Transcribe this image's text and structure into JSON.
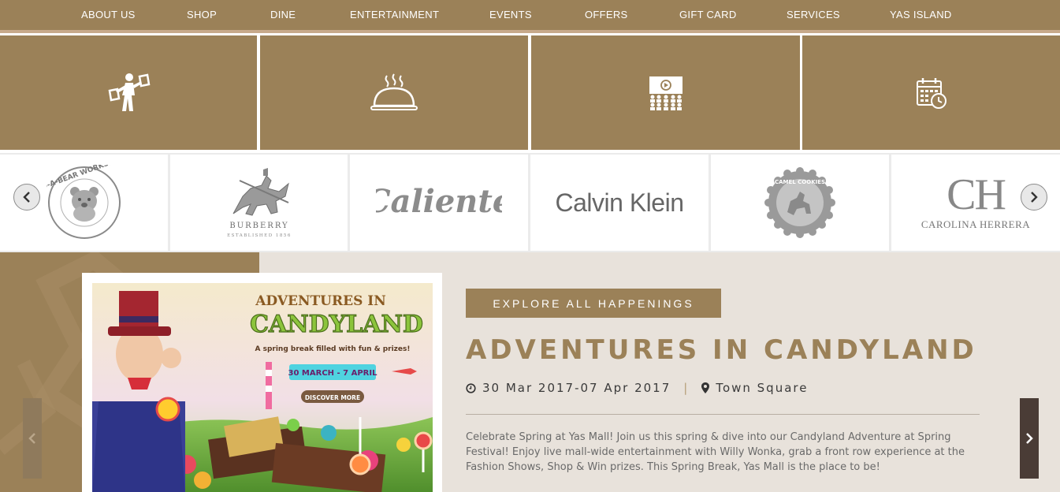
{
  "nav": {
    "items": [
      "ABOUT US",
      "SHOP",
      "DINE",
      "ENTERTAINMENT",
      "EVENTS",
      "OFFERS",
      "GIFT CARD",
      "SERVICES",
      "YAS ISLAND"
    ]
  },
  "category_tiles": [
    {
      "icon": "shopping-person-icon"
    },
    {
      "icon": "dining-cloche-icon"
    },
    {
      "icon": "cinema-audience-icon"
    },
    {
      "icon": "calendar-clock-icon"
    }
  ],
  "brands": {
    "items": [
      {
        "name": "BUILD-A-BEAR WORKSHOP"
      },
      {
        "name": "BURBERRY",
        "sub": "ESTABLISHED 1856"
      },
      {
        "name": "Caliente"
      },
      {
        "name": "Calvin Klein"
      },
      {
        "name": "CAMEL COOKIES"
      },
      {
        "name": "CH",
        "sub": "CAROLINA HERRERA"
      }
    ],
    "prev_icon": "chevron-left-icon",
    "next_icon": "chevron-right-icon"
  },
  "hero": {
    "explore_label": "EXPLORE ALL HAPPENINGS",
    "title": "ADVENTURES IN CANDYLAND",
    "date": "30 Mar 2017-07 Apr 2017",
    "separator": "|",
    "location": "Town Square",
    "description": "Celebrate Spring at Yas Mall! Join us this spring & dive into our Candyland Adventure at Spring Festival! Enjoy live mall-wide entertainment with Willy Wonka, grab a front row experience at the Fashion Shows, Shop & Win prizes. This Spring Break, Yas Mall is the place to be!",
    "poster": {
      "headline_top": "ADVENTURES IN",
      "headline_main": "CANDYLAND",
      "tagline": "A spring break filled with fun & prizes!",
      "dates": "30 MARCH - 7 APRIL",
      "cta": "DISCOVER MORE"
    }
  },
  "colors": {
    "brand_gold": "#9b8158",
    "hero_bg": "#e8e2db",
    "title_gold": "#9b8158",
    "next_button_bg": "#4a3c36"
  }
}
